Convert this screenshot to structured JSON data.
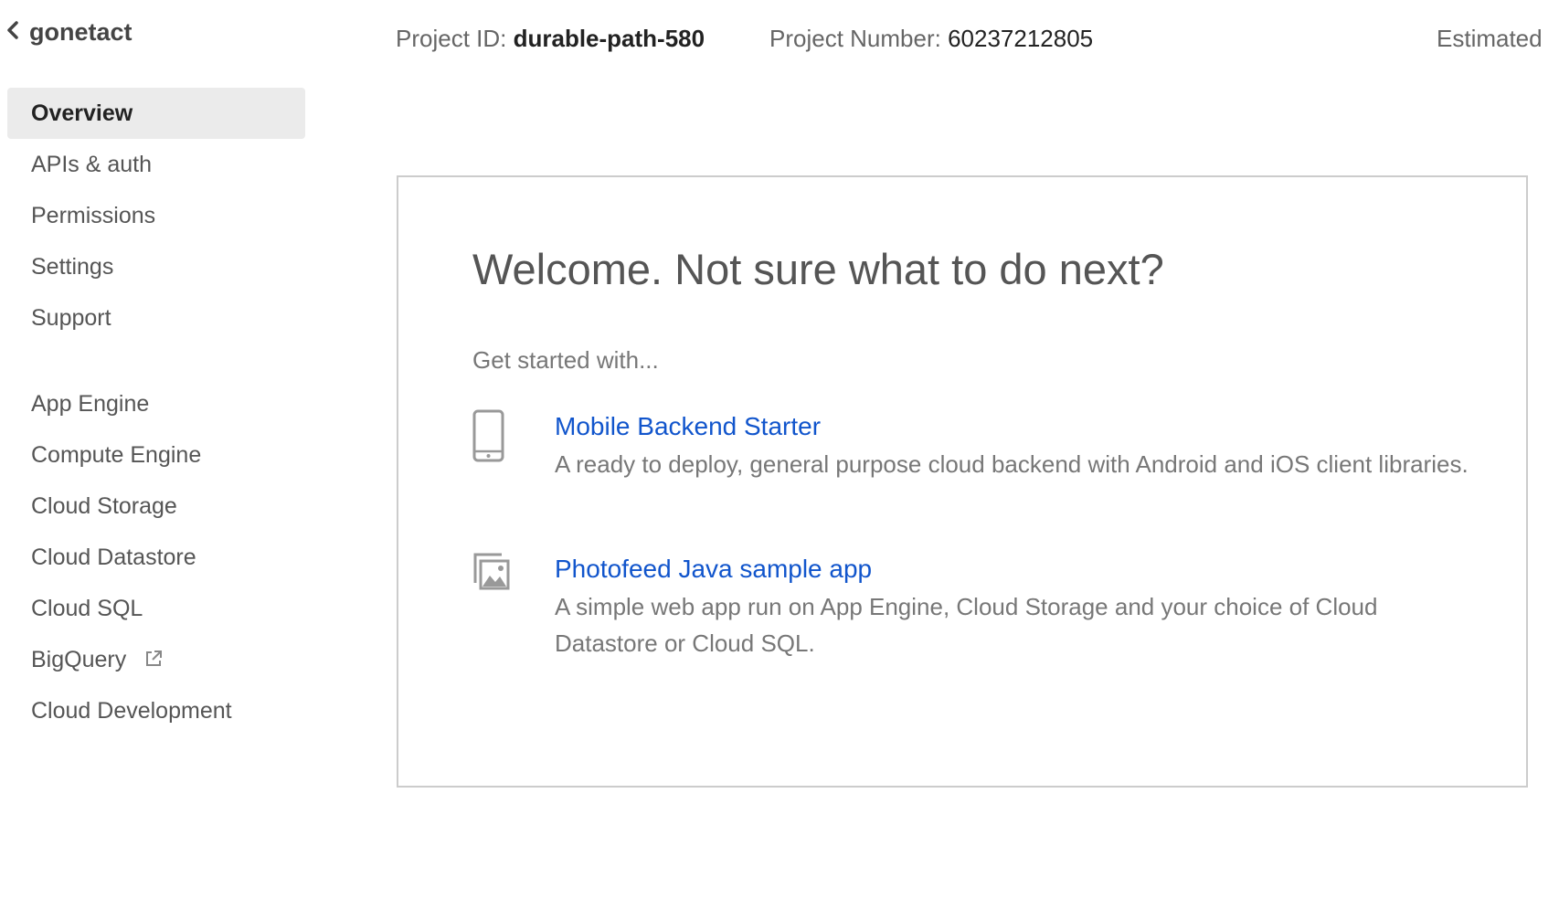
{
  "project": {
    "name": "gonetact",
    "back_icon": "chevron-left-icon",
    "id_label": "Project ID:",
    "id_value": "durable-path-580",
    "number_label": "Project Number:",
    "number_value": "60237212805",
    "estimated_label": "Estimated"
  },
  "sidebar": {
    "items": [
      {
        "label": "Overview",
        "active": true
      },
      {
        "label": "APIs & auth"
      },
      {
        "label": "Permissions"
      },
      {
        "label": "Settings"
      },
      {
        "label": "Support"
      },
      {
        "label": "App Engine"
      },
      {
        "label": "Compute Engine"
      },
      {
        "label": "Cloud Storage"
      },
      {
        "label": "Cloud Datastore"
      },
      {
        "label": "Cloud SQL"
      },
      {
        "label": "BigQuery",
        "icon": "external-link-icon"
      },
      {
        "label": "Cloud Development"
      }
    ]
  },
  "welcome": {
    "title": "Welcome. Not sure what to do next?",
    "subtitle": "Get started with...",
    "starters": [
      {
        "icon": "mobile-phone-icon",
        "title": "Mobile Backend Starter",
        "description": "A ready to deploy, general purpose cloud backend with Android and iOS client libraries."
      },
      {
        "icon": "image-gallery-icon",
        "title": "Photofeed Java sample app",
        "description": "A simple web app run on App Engine, Cloud Storage and your choice of Cloud Datastore or Cloud SQL."
      }
    ]
  },
  "colors": {
    "link": "#1155cc",
    "active_bg": "#ebebeb",
    "card_border": "#cccccc"
  }
}
